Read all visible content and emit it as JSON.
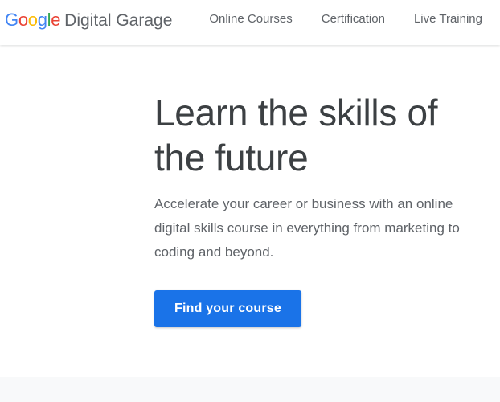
{
  "header": {
    "logo": {
      "letters": [
        "G",
        "o",
        "o",
        "g",
        "l",
        "e"
      ],
      "colors": [
        "#4285F4",
        "#EA4335",
        "#FBBC05",
        "#4285F4",
        "#34A853",
        "#EA4335"
      ]
    },
    "brand_name": "Digital Garage",
    "nav": [
      {
        "label": "Online Courses"
      },
      {
        "label": "Certification"
      },
      {
        "label": "Live Training"
      }
    ]
  },
  "hero": {
    "title": "Learn the skills of the future",
    "description": "Accelerate your career or business with an online digital skills course in everything from marketing to coding and beyond.",
    "cta_label": "Find your course"
  },
  "colors": {
    "accent": "#1a73e8",
    "heading": "#3c4043",
    "body_text": "#5f6368",
    "band": "#f8f9fa"
  }
}
